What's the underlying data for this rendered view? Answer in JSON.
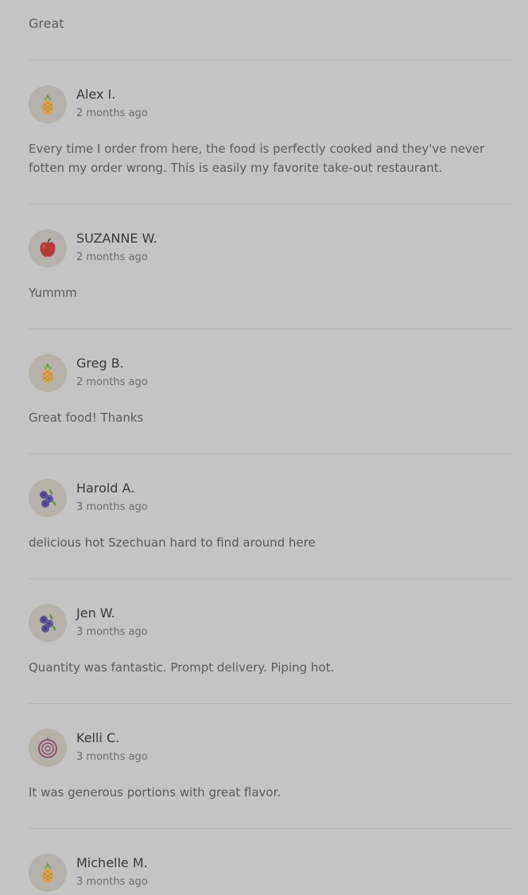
{
  "first_review_text": "Great",
  "reviews": [
    {
      "name": "Alex I.",
      "time": "2 months ago",
      "text": "Every time I order from here, the food is perfectly cooked and they've never fotten my order wrong. This is easily my favorite take-out restaurant.",
      "avatar_icon": "pineapple-icon"
    },
    {
      "name": "SUZANNE W.",
      "time": "2 months ago",
      "text": "Yummm",
      "avatar_icon": "apple-icon"
    },
    {
      "name": "Greg B.",
      "time": "2 months ago",
      "text": "Great food! Thanks",
      "avatar_icon": "pineapple-icon"
    },
    {
      "name": "Harold A.",
      "time": "3 months ago",
      "text": "delicious hot Szechuan hard to find around here",
      "avatar_icon": "blueberry-icon"
    },
    {
      "name": "Jen W.",
      "time": "3 months ago",
      "text": "Quantity was fantastic. Prompt delivery. Piping hot.",
      "avatar_icon": "blueberry-icon"
    },
    {
      "name": "Kelli C.",
      "time": "3 months ago",
      "text": "It was generous portions with great flavor.",
      "avatar_icon": "onion-icon"
    },
    {
      "name": "Michelle M.",
      "time": "3 months ago",
      "text": "",
      "avatar_icon": "pineapple-icon"
    }
  ]
}
